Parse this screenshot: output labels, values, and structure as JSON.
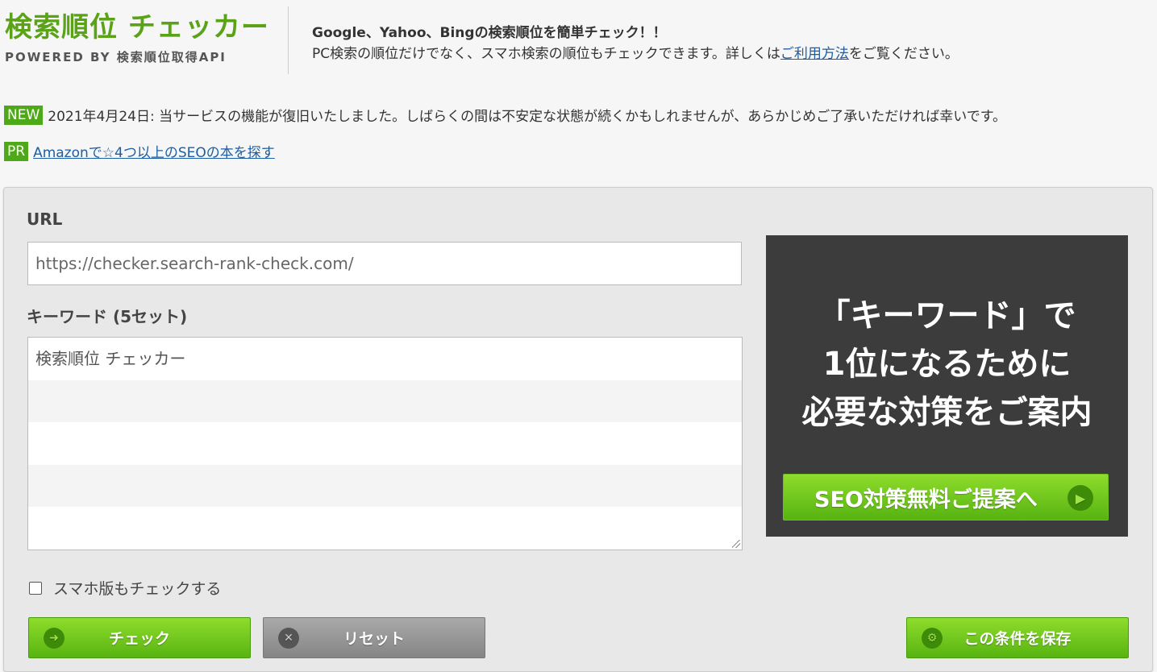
{
  "header": {
    "logo_title": "検索順位 チェッカー",
    "logo_sub": "POWERED BY 検索順位取得API",
    "tagline_1": "Google、Yahoo、Bingの検索順位を簡単チェック！！",
    "tagline_2_pre": "PC検索の順位だけでなく、スマホ検索の順位もチェックできます。詳しくは",
    "tagline_2_link": "ご利用方法",
    "tagline_2_post": "をご覧ください。"
  },
  "notices": {
    "new_badge": "NEW",
    "new_text": "2021年4月24日: 当サービスの機能が復旧いたしました。しばらくの間は不安定な状態が続くかもしれませんが、あらかじめご了承いただければ幸いです。",
    "pr_badge": "PR",
    "pr_link": "Amazonで☆4つ以上のSEOの本を探す"
  },
  "form": {
    "url_label": "URL",
    "url_value": "https://checker.search-rank-check.com/",
    "keyword_label": "キーワード (5セット)",
    "keywords": [
      "検索順位 チェッカー",
      "",
      "",
      "",
      ""
    ],
    "smartphone_checkbox_label": "スマホ版もチェックする",
    "smartphone_checked": false,
    "check_button": "チェック",
    "reset_button": "リセット",
    "save_button": "この条件を保存"
  },
  "ad": {
    "line1": "「キーワード」で",
    "line2": "1位になるために",
    "line3": "必要な対策をご案内",
    "button": "SEO対策無料ご提案へ"
  },
  "colors": {
    "brand_green": "#5aa317",
    "badge_green": "#4ea918",
    "link_blue": "#1a5ea8",
    "ad_bg": "#3c3c3c"
  }
}
